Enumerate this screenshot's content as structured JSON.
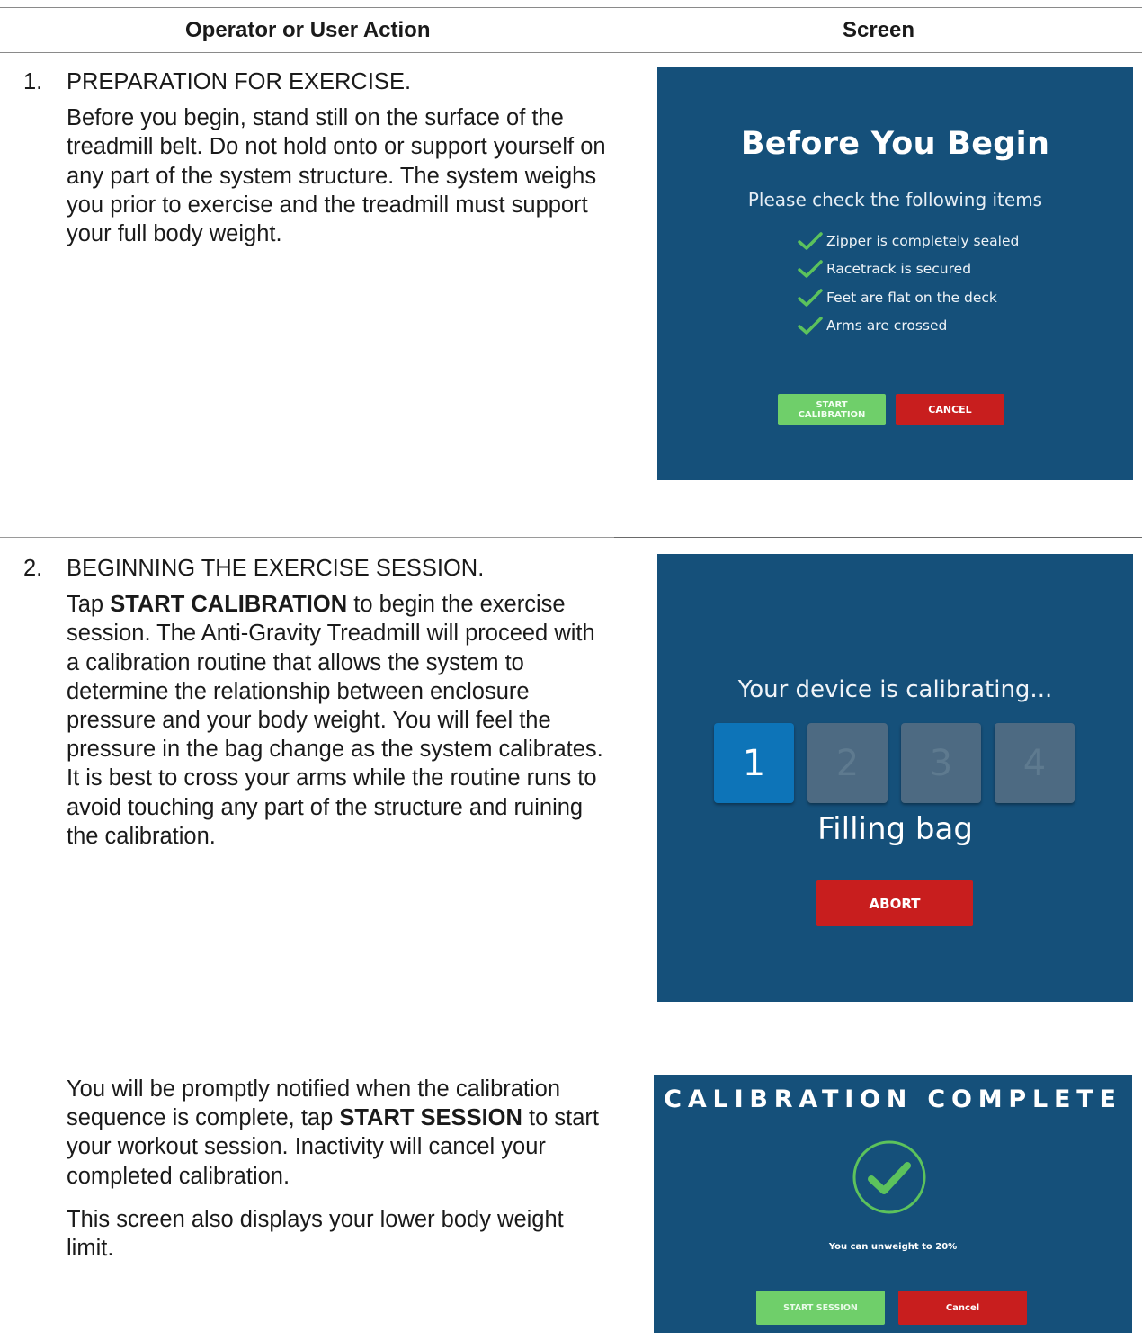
{
  "header": {
    "col_action": "Operator or User Action",
    "col_screen": "Screen"
  },
  "rows": [
    {
      "number": "1.",
      "heading": "PREPARATION FOR EXERCISE.",
      "body": "Before you begin, stand still on the surface of the treadmill belt. Do not hold onto or support yourself on any part of the system structure. The system weighs you prior to exercise and the treadmill must support your full body weight."
    },
    {
      "number": "2.",
      "heading": "BEGINNING THE EXERCISE SESSION.",
      "body_pre": "Tap ",
      "body_bold": "START CALIBRATION",
      "body_post": " to begin the exercise session. The Anti-Gravity Treadmill will proceed with a calibration routine that allows the system to determine the relationship between enclosure pressure and your body weight. You will feel the pressure in the bag change as the system calibrates. It is best to cross your arms while the routine runs to avoid touching any part of the structure and ruining the calibration."
    },
    {
      "body_pre": "You will be promptly notified when the calibration sequence is complete, tap ",
      "body_bold": "START SESSION",
      "body_post": " to start your workout session. Inactivity will cancel your completed calibration.",
      "body2": "This screen also displays your lower body weight limit."
    }
  ],
  "screen1": {
    "title": "Before You Begin",
    "subtitle": "Please check the following items",
    "checklist": [
      "Zipper is completely sealed",
      "Racetrack is secured",
      "Feet are flat on the deck",
      "Arms are crossed"
    ],
    "start_line1": "START",
    "start_line2": "CALIBRATION",
    "cancel": "CANCEL"
  },
  "screen2": {
    "message": "Your device is calibrating...",
    "steps": [
      "1",
      "2",
      "3",
      "4"
    ],
    "active_step": 1,
    "status": "Filling bag",
    "abort": "ABORT"
  },
  "screen3": {
    "title": "CALIBRATION COMPLETE",
    "limit_text": "You can unweight to 20%",
    "start_session": "START SESSION",
    "cancel": "Cancel"
  },
  "colors": {
    "screen_bg": "#15507a",
    "green": "#6fcf6a",
    "red": "#c81e1e",
    "active_step": "#0d74b8",
    "check": "#5cc25c"
  }
}
